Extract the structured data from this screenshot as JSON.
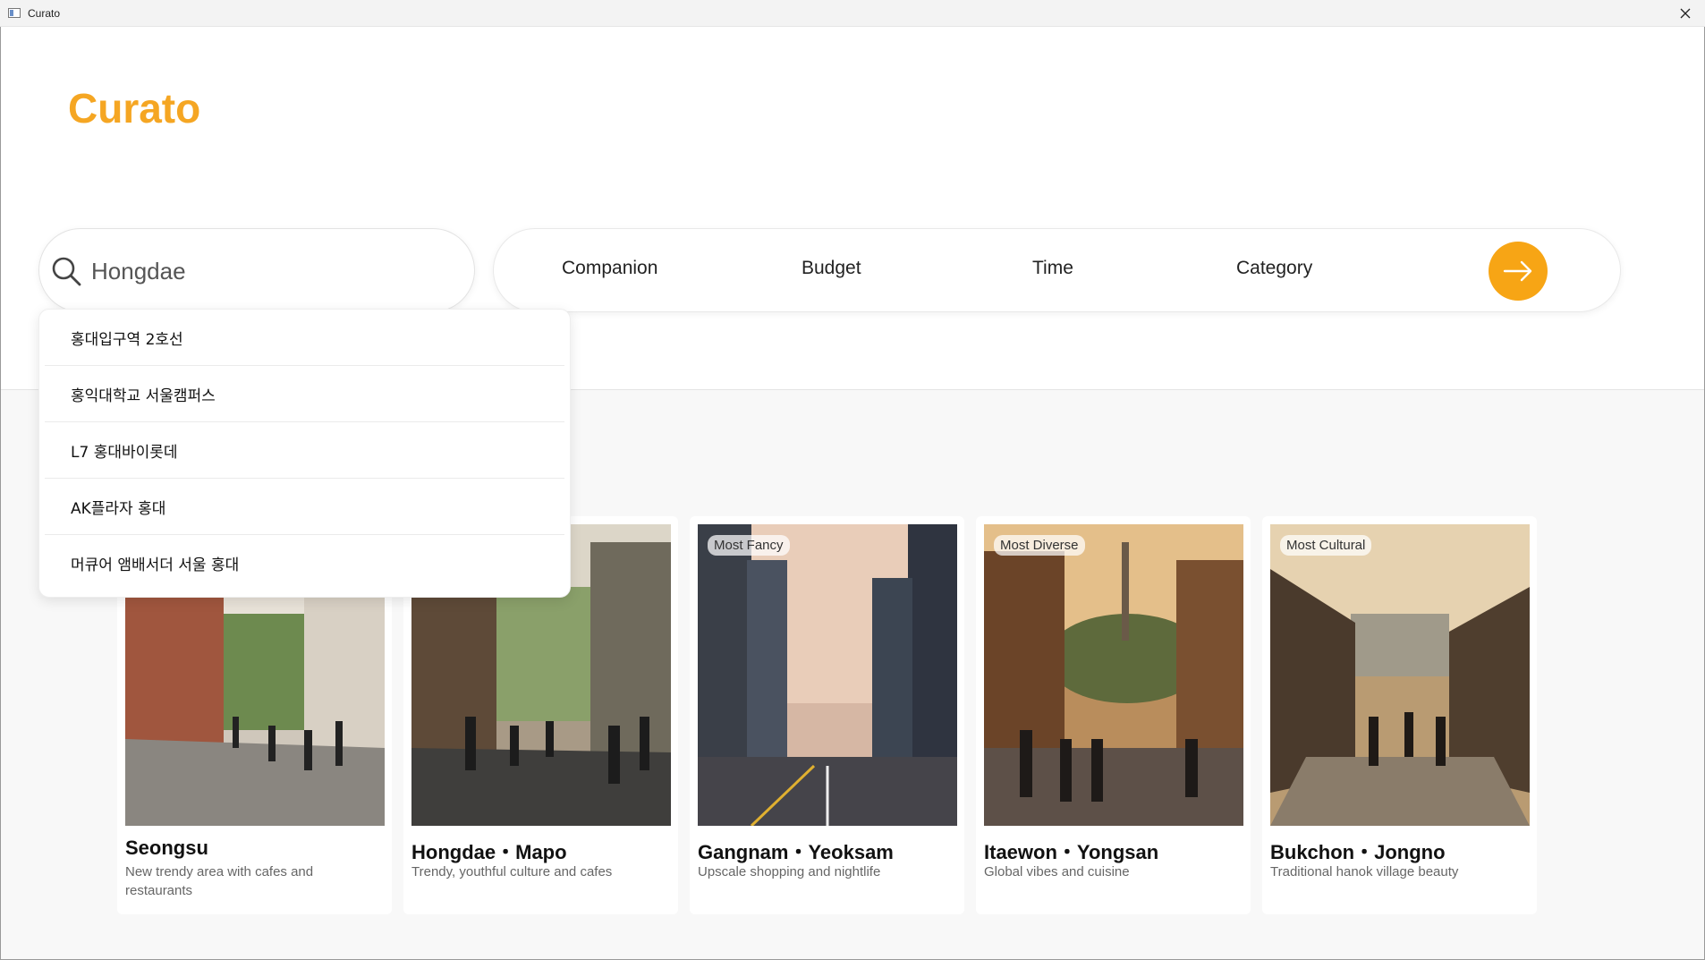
{
  "window": {
    "title": "Curato"
  },
  "header": {
    "logo": "Curato"
  },
  "search": {
    "value": "Hongdae",
    "placeholder": ""
  },
  "filters": {
    "companion": "Companion",
    "budget": "Budget",
    "time": "Time",
    "category": "Category"
  },
  "colors": {
    "accent": "#f5a623",
    "go_button": "#f7a515"
  },
  "dropdown": {
    "items": [
      "홍대입구역 2호선",
      "홍익대학교 서울캠퍼스",
      "L7 홍대바이롯데",
      "AK플라자 홍대",
      "머큐어 앰배서더 서울 홍대"
    ]
  },
  "cards": [
    {
      "badge": "",
      "title": "Seongsu",
      "description": "New trendy area with cafes and restaurants"
    },
    {
      "badge": "",
      "title": "Hongdae・Mapo",
      "description": "Trendy, youthful culture and cafes"
    },
    {
      "badge": "Most Fancy",
      "title": "Gangnam・Yeoksam",
      "description": "Upscale shopping and nightlife"
    },
    {
      "badge": "Most Diverse",
      "title": "Itaewon・Yongsan",
      "description": "Global vibes and cuisine"
    },
    {
      "badge": "Most Cultural",
      "title": "Bukchon・Jongno",
      "description": "Traditional hanok village beauty"
    }
  ]
}
